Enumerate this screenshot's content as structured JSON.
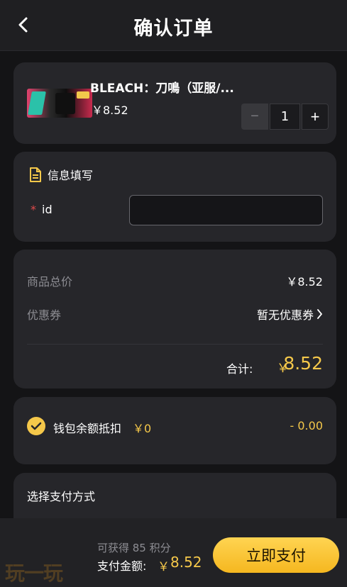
{
  "header": {
    "title": "确认订单",
    "back_icon": "chevron-left-icon"
  },
  "product": {
    "name": "BLEACH：刀鳴（亚服/...",
    "price": "￥8.52",
    "quantity": "1",
    "minus_label": "−",
    "plus_label": "+"
  },
  "info": {
    "title": "信息填写",
    "title_icon": "document-icon",
    "id_required_mark": "*",
    "id_label": "id",
    "id_value": ""
  },
  "pricing": {
    "subtotal_label": "商品总价",
    "subtotal_value": "￥8.52",
    "coupon_label": "优惠券",
    "coupon_value": "暂无优惠券",
    "total_label": "合计:",
    "total_currency": "￥",
    "total_value": "8.52"
  },
  "wallet": {
    "label": "钱包余额抵扣",
    "balance": "￥0",
    "deduction": "- 0.00",
    "checked": true
  },
  "payment": {
    "title": "选择支付方式"
  },
  "footer": {
    "points_text": "可获得 85 积分",
    "amount_label": "支付金额:",
    "amount_currency": "￥",
    "amount_value": "8.52",
    "pay_button_label": "立即支付",
    "watermark": "玩一玩"
  },
  "colors": {
    "accent": "#f5c84a",
    "background": "#141416",
    "card": "#26262a",
    "required": "#e14b4b"
  }
}
